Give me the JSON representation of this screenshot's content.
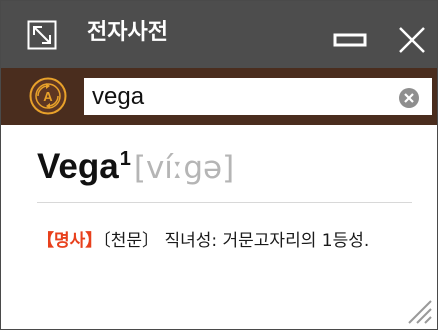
{
  "window": {
    "title": "전자사전"
  },
  "search": {
    "value": "vega",
    "lang_icon_label": "A"
  },
  "entry": {
    "headword": "Vega",
    "superscript": "1",
    "pronunciation": "[víːgə]",
    "part_of_speech": "【명사】",
    "definition": "〔천문〕 직녀성: 거문고자리의 1등성."
  },
  "colors": {
    "titlebar": "#4d4d4d",
    "searchbar": "#4a2d1e",
    "accent_orange": "#e8a12a",
    "pos_red": "#e8401c",
    "pronunciation_gray": "#b5b5b5"
  },
  "icons": {
    "expand": "expand-icon",
    "minimize": "minimize-icon",
    "close": "close-icon",
    "language": "language-toggle-icon",
    "clear": "clear-icon",
    "resize": "resize-grip-icon"
  }
}
